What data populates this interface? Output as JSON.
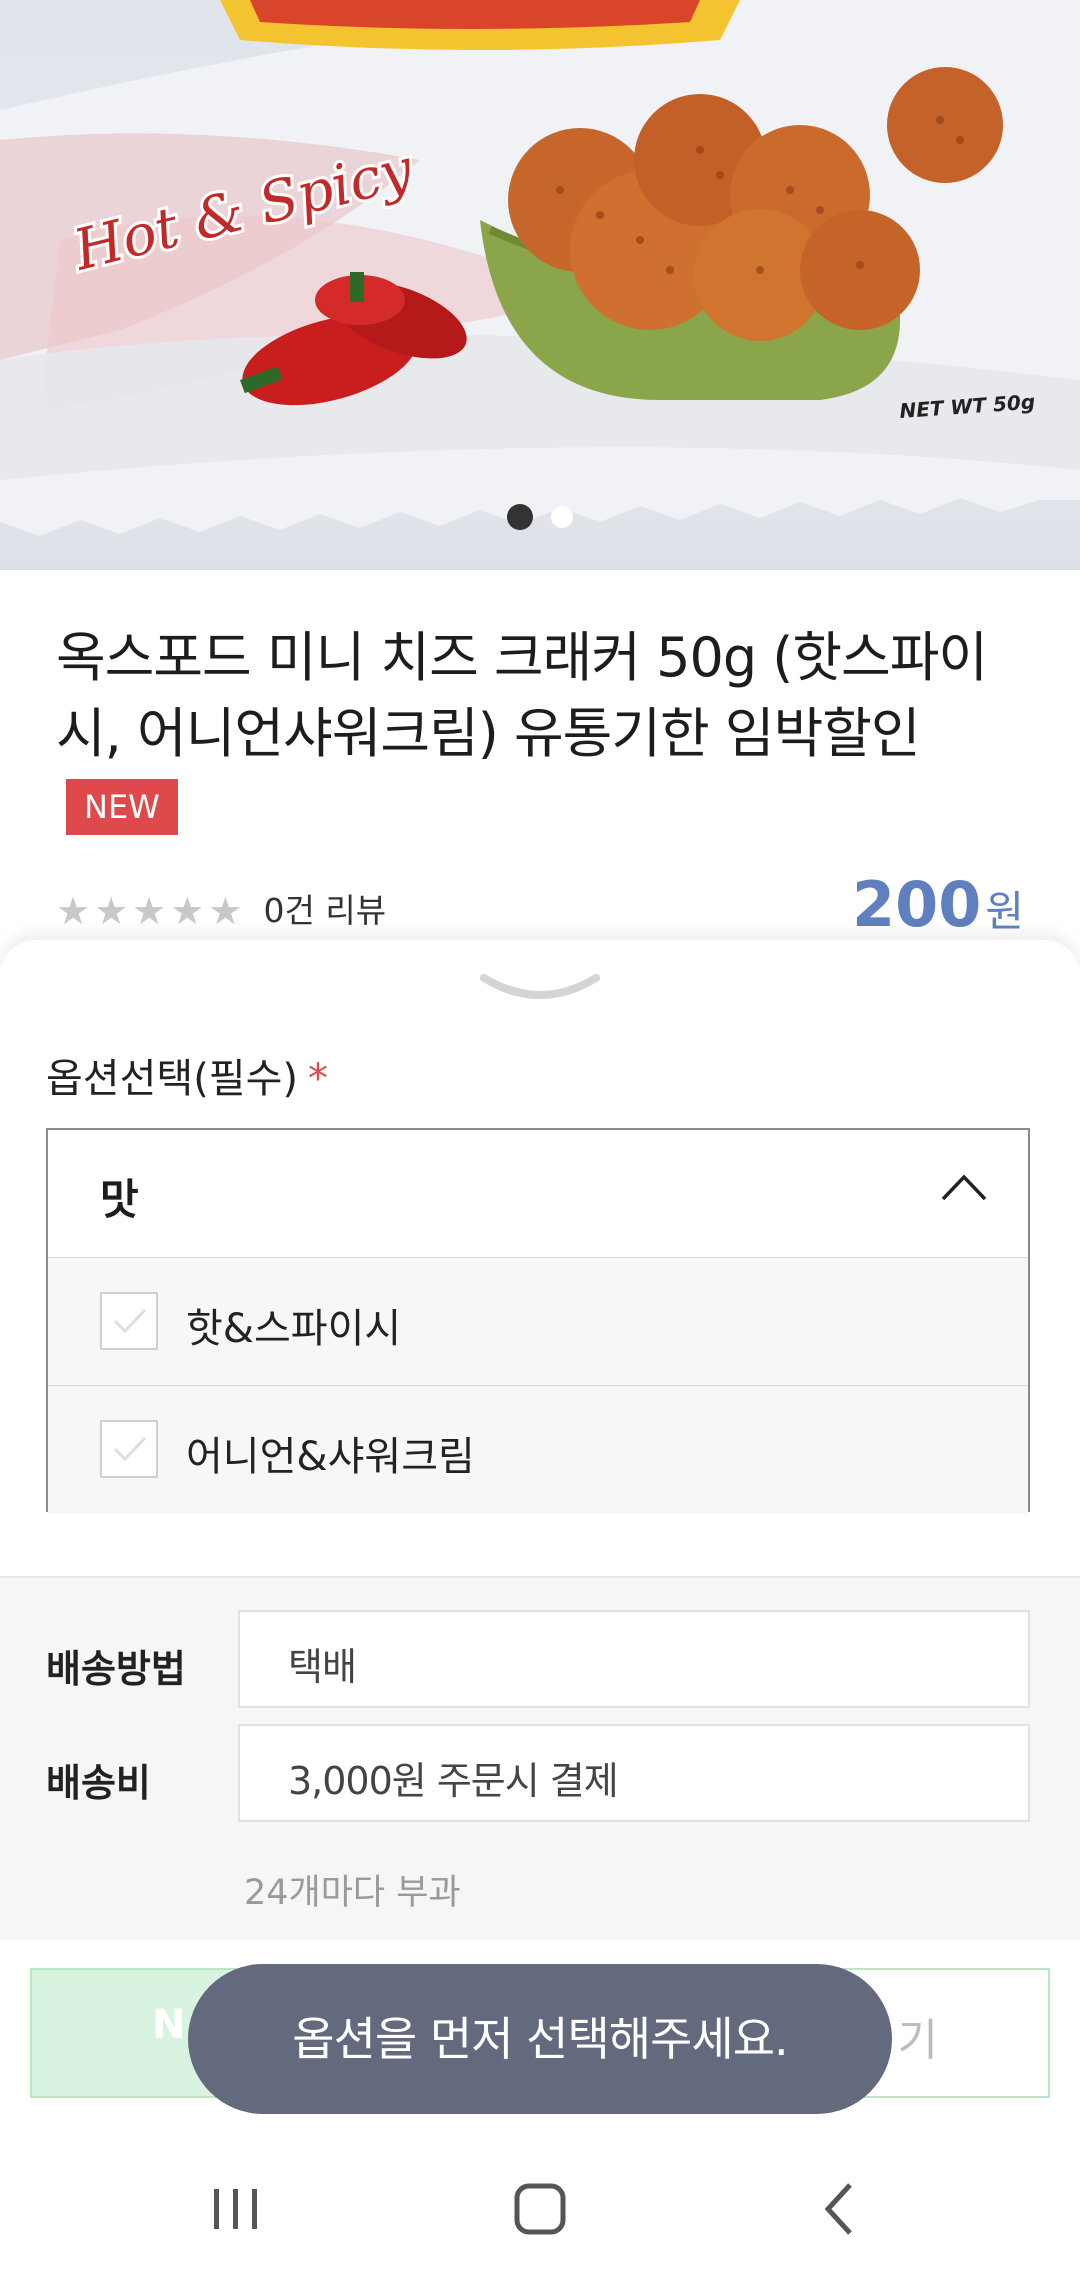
{
  "product": {
    "image_alt": "Hot & Spicy cracker package",
    "package_text": "Hot & Spicy",
    "net_weight": "NET WT 50g",
    "title": "옥스포드 미니 치즈 크래커 50g (핫스파이시, 어니언샤워크림) 유통기한 임박할인",
    "badge": "NEW",
    "rating_stars": 0,
    "review_text": "0건 리뷰",
    "price": "200",
    "price_unit": "원",
    "carousel": {
      "count": 2,
      "active": 0
    }
  },
  "options": {
    "label": "옵션선택(필수)",
    "required_mark": "*",
    "dropdown_title": "맛",
    "items": [
      {
        "label": "핫&스파이시",
        "checked": false
      },
      {
        "label": "어니언&샤워크림",
        "checked": false
      }
    ]
  },
  "shipping": {
    "method_label": "배송방법",
    "method_value": "택배",
    "fee_label": "배송비",
    "fee_value": "3,000원 주문시 결제",
    "note": "24개마다 부과"
  },
  "buttons": {
    "buy_label": "N",
    "cart_label": "기"
  },
  "toast": "옵션을 먼저 선택해주세요.",
  "colors": {
    "accent_price": "#5f7fbf",
    "badge_new": "#e0494b",
    "toast_bg": "#636a7e",
    "buy_button_bg": "#d8f3df"
  }
}
